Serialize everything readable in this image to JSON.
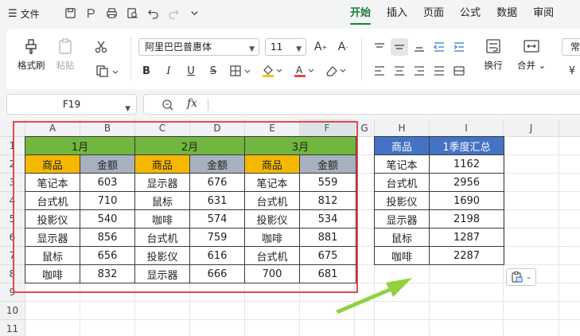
{
  "titlebar": {
    "file_label": "文件",
    "tabs": [
      "开始",
      "插入",
      "页面",
      "公式",
      "数据",
      "审阅"
    ],
    "active_tab": "开始"
  },
  "ribbon": {
    "format_painter": "格式刷",
    "paste": "粘贴",
    "font_name": "阿里巴巴普惠体",
    "font_size": "11",
    "wrap": "换行",
    "merge": "合并",
    "number_format": "常",
    "accent_color": "#1a7f37"
  },
  "formula_bar": {
    "cell_ref": "F19",
    "fx": "fx",
    "value": ""
  },
  "grid": {
    "columns": [
      "A",
      "B",
      "C",
      "D",
      "E",
      "F",
      "G",
      "H",
      "I",
      "J"
    ],
    "selected_column": "F",
    "rows": [
      "1",
      "2",
      "3",
      "4",
      "5",
      "6",
      "7",
      "8",
      "9",
      "10",
      "11"
    ]
  },
  "sales_table": {
    "months": [
      "1月",
      "2月",
      "3月"
    ],
    "header": [
      "商品",
      "金额",
      "商品",
      "金额",
      "商品",
      "金额"
    ],
    "rows": [
      [
        "笔记本",
        "603",
        "显示器",
        "676",
        "笔记本",
        "559"
      ],
      [
        "台式机",
        "710",
        "鼠标",
        "631",
        "台式机",
        "812"
      ],
      [
        "投影仪",
        "540",
        "咖啡",
        "574",
        "投影仪",
        "534"
      ],
      [
        "显示器",
        "856",
        "台式机",
        "759",
        "咖啡",
        "881"
      ],
      [
        "鼠标",
        "656",
        "投影仪",
        "616",
        "台式机",
        "675"
      ],
      [
        "咖啡",
        "832",
        "显示器",
        "666",
        "700",
        "681"
      ]
    ]
  },
  "summary_table": {
    "header": [
      "商品",
      "1季度汇总"
    ],
    "rows": [
      [
        "笔记本",
        "1162"
      ],
      [
        "台式机",
        "2956"
      ],
      [
        "投影仪",
        "1690"
      ],
      [
        "显示器",
        "2198"
      ],
      [
        "鼠标",
        "1287"
      ],
      [
        "咖啡",
        "2287"
      ]
    ]
  },
  "colors": {
    "month_header": "#70b63f",
    "name_header": "#f5b800",
    "amount_header": "#a7b1c0",
    "summary_header": "#4472c4",
    "highlight_box": "#e5484d",
    "arrow": "#8fd13f"
  }
}
